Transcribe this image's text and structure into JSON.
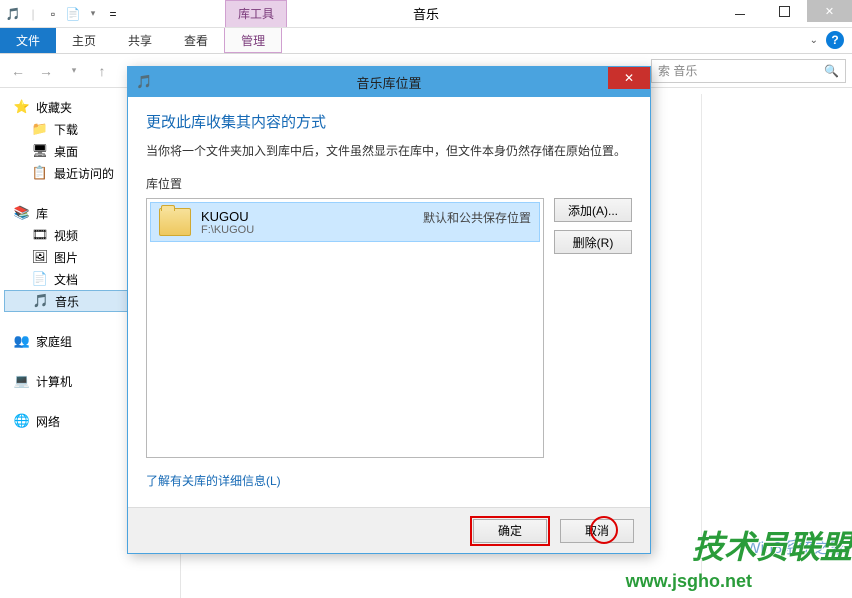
{
  "titlebar": {
    "toolTab": "库工具",
    "title": "音乐"
  },
  "ribbon": {
    "file": "文件",
    "tabs": [
      "主页",
      "共享",
      "查看",
      "管理"
    ]
  },
  "navbar": {
    "searchPlaceholder": "索 音乐"
  },
  "sidebar": {
    "favorites": {
      "label": "收藏夹",
      "items": [
        "下载",
        "桌面",
        "最近访问的"
      ]
    },
    "libraries": {
      "label": "库",
      "items": [
        "视频",
        "图片",
        "文档",
        "音乐"
      ]
    },
    "homegroup": "家庭组",
    "computer": "计算机",
    "network": "网络"
  },
  "dialog": {
    "title": "音乐库位置",
    "heading": "更改此库收集其内容的方式",
    "description": "当你将一个文件夹加入到库中后，文件虽然显示在库中，但文件本身仍然存储在原始位置。",
    "listLabel": "库位置",
    "item": {
      "name": "KUGOU",
      "path": "F:\\KUGOU",
      "default": "默认和公共保存位置"
    },
    "addBtn": "添加(A)...",
    "removeBtn": "删除(R)",
    "link": "了解有关库的详细信息(L)",
    "ok": "确定",
    "cancel": "取消"
  },
  "watermarks": {
    "w1": "技术员联盟",
    "w2": "Win8系统之家",
    "w3": "www.jsgho.net"
  }
}
